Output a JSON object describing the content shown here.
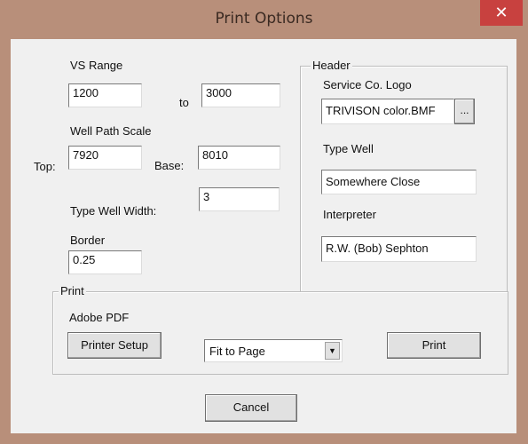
{
  "window": {
    "title": "Print Options",
    "close_glyph": "✕"
  },
  "vs_range": {
    "label": "VS Range",
    "from": "1200",
    "to_label": "to",
    "to": "3000"
  },
  "well_path_scale": {
    "label": "Well Path Scale",
    "top_label": "Top:",
    "top": "7920",
    "base_label": "Base:",
    "base": "8010"
  },
  "type_well_width": {
    "label": "Type Well Width:",
    "value": "3"
  },
  "border": {
    "label": "Border",
    "value": "0.25"
  },
  "header": {
    "legend": "Header",
    "logo_label": "Service Co. Logo",
    "logo_value": "TRIVISON color.BMF",
    "browse_label": "...",
    "type_well_label": "Type Well",
    "type_well_value": "Somewhere Close",
    "interpreter_label": "Interpreter",
    "interpreter_value": "R.W. (Bob) Sephton"
  },
  "print": {
    "legend": "Print",
    "printer_name": "Adobe PDF",
    "printer_setup_label": "Printer Setup",
    "fit_option": "Fit to Page",
    "print_label": "Print"
  },
  "cancel_label": "Cancel"
}
